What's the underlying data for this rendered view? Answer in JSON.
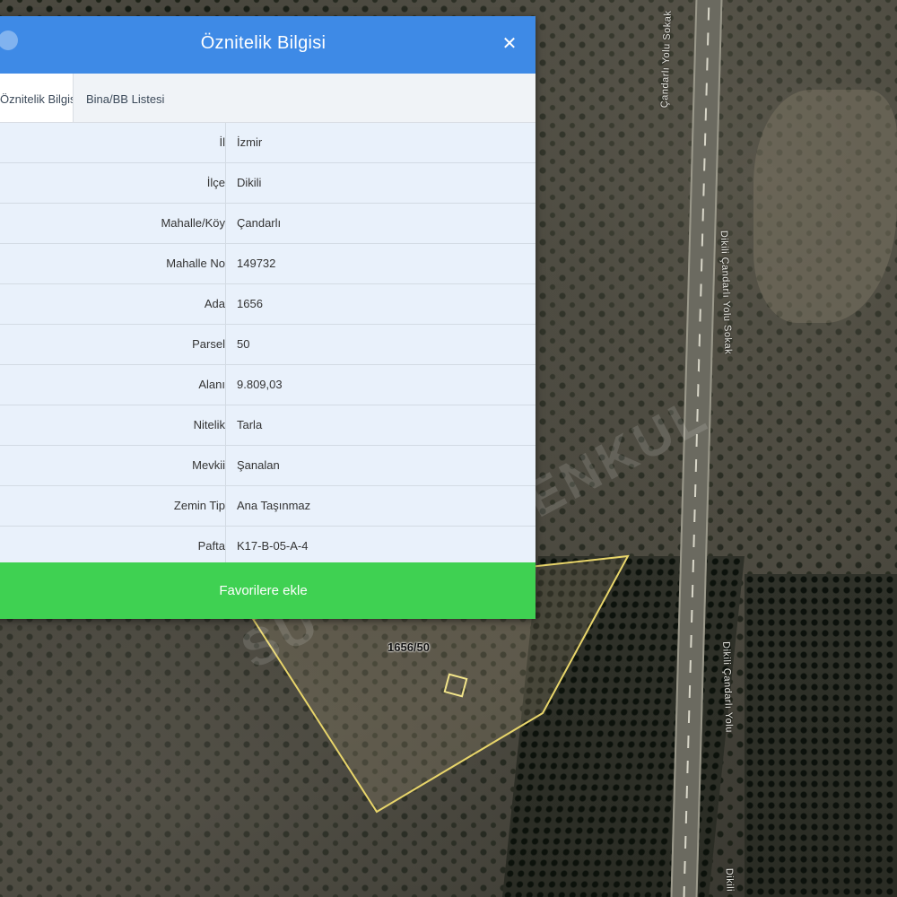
{
  "colors": {
    "header": "#3e8ae6",
    "favorite_button": "#3fd152",
    "row_bg": "#e9f1fb",
    "parcel_outline": "#e8d56a"
  },
  "map": {
    "road_labels": [
      "Çandarlı Yolu Sokak",
      "Dikili Çandarlı Yolu Sokak",
      "Dikili Çandarlı Yolu",
      "Dikili"
    ],
    "parcel_label": "1656/50",
    "watermark": "SU GAYRİMENKUL"
  },
  "dialog": {
    "title": "Öznitelik Bilgisi",
    "close_icon": "close-icon",
    "tabs": [
      {
        "label": "Öznitelik Bilgisi"
      },
      {
        "label": "Bina/BB Listesi"
      }
    ],
    "rows": [
      {
        "key": "İl",
        "value": "İzmir"
      },
      {
        "key": "İlçe",
        "value": "Dikili"
      },
      {
        "key": "Mahalle/Köy",
        "value": "Çandarlı"
      },
      {
        "key": "Mahalle No",
        "value": "149732"
      },
      {
        "key": "Ada",
        "value": "1656"
      },
      {
        "key": "Parsel",
        "value": "50"
      },
      {
        "key": "Alanı",
        "value": "9.809,03"
      },
      {
        "key": "Nitelik",
        "value": "Tarla"
      },
      {
        "key": "Mevkii",
        "value": "Şanalan"
      },
      {
        "key": "Zemin Tip",
        "value": "Ana Taşınmaz"
      },
      {
        "key": "Pafta",
        "value": "K17-B-05-A-4"
      }
    ],
    "favorite_label": "Favorilere ekle"
  }
}
